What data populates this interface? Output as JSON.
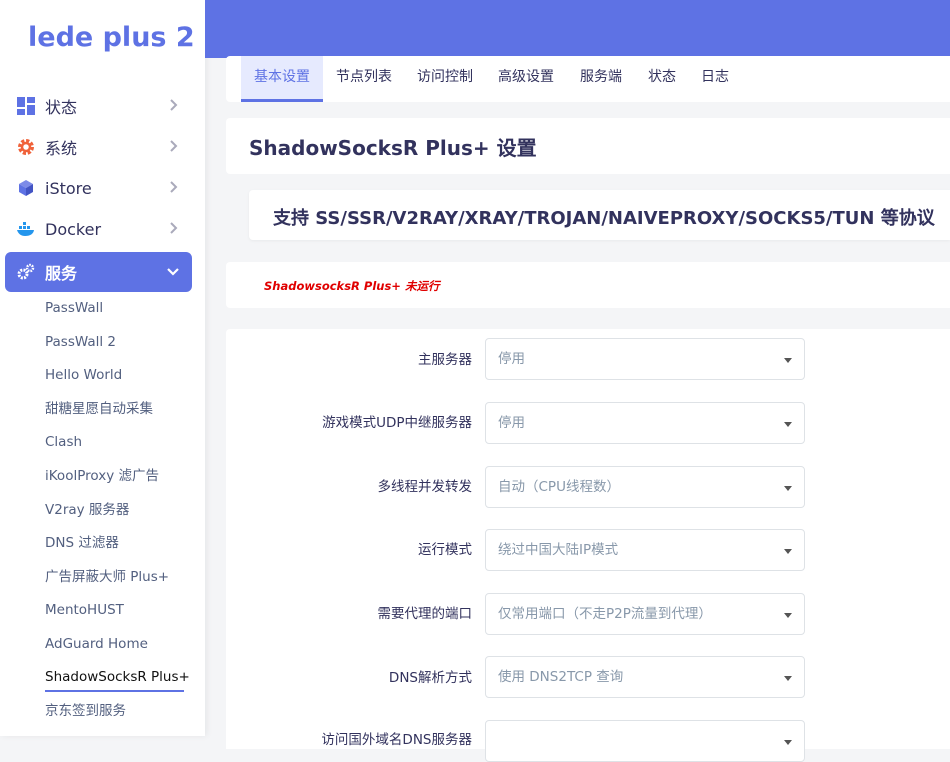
{
  "brand": "lede plus 2",
  "sidebar": {
    "items": [
      {
        "label": "状态",
        "icon": "dashboard-icon"
      },
      {
        "label": "系统",
        "icon": "gear-icon"
      },
      {
        "label": "iStore",
        "icon": "cube-icon"
      },
      {
        "label": "Docker",
        "icon": "docker-icon"
      },
      {
        "label": "服务",
        "icon": "cogs-icon",
        "active": true
      }
    ],
    "sub_items": [
      "PassWall",
      "PassWall 2",
      "Hello World",
      "甜糖星愿自动采集",
      "Clash",
      "iKoolProxy 滤广告",
      "V2ray 服务器",
      "DNS 过滤器",
      "广告屏蔽大师 Plus+",
      "MentoHUST",
      "AdGuard Home",
      "ShadowSocksR Plus+",
      "京东签到服务"
    ]
  },
  "tabs": [
    "基本设置",
    "节点列表",
    "访问控制",
    "高级设置",
    "服务端",
    "状态",
    "日志"
  ],
  "page_title": "ShadowSocksR Plus+ 设置",
  "protocol_banner": "支持 SS/SSR/V2RAY/XRAY/TROJAN/NAIVEPROXY/SOCKS5/TUN 等协议",
  "status_text": "ShadowsocksR Plus+ 未运行",
  "form": {
    "rows": [
      {
        "label": "主服务器",
        "value": "停用"
      },
      {
        "label": "游戏模式UDP中继服务器",
        "value": "停用"
      },
      {
        "label": "多线程并发转发",
        "value": "自动（CPU线程数）"
      },
      {
        "label": "运行模式",
        "value": "绕过中国大陆IP模式"
      },
      {
        "label": "需要代理的端口",
        "value": "仅常用端口（不走P2P流量到代理）"
      },
      {
        "label": "DNS解析方式",
        "value": "使用 DNS2TCP 查询"
      },
      {
        "label": "访问国外域名DNS服务器",
        "value": ""
      }
    ]
  },
  "colors": {
    "accent": "#5e72e4",
    "error": "#e00000"
  }
}
